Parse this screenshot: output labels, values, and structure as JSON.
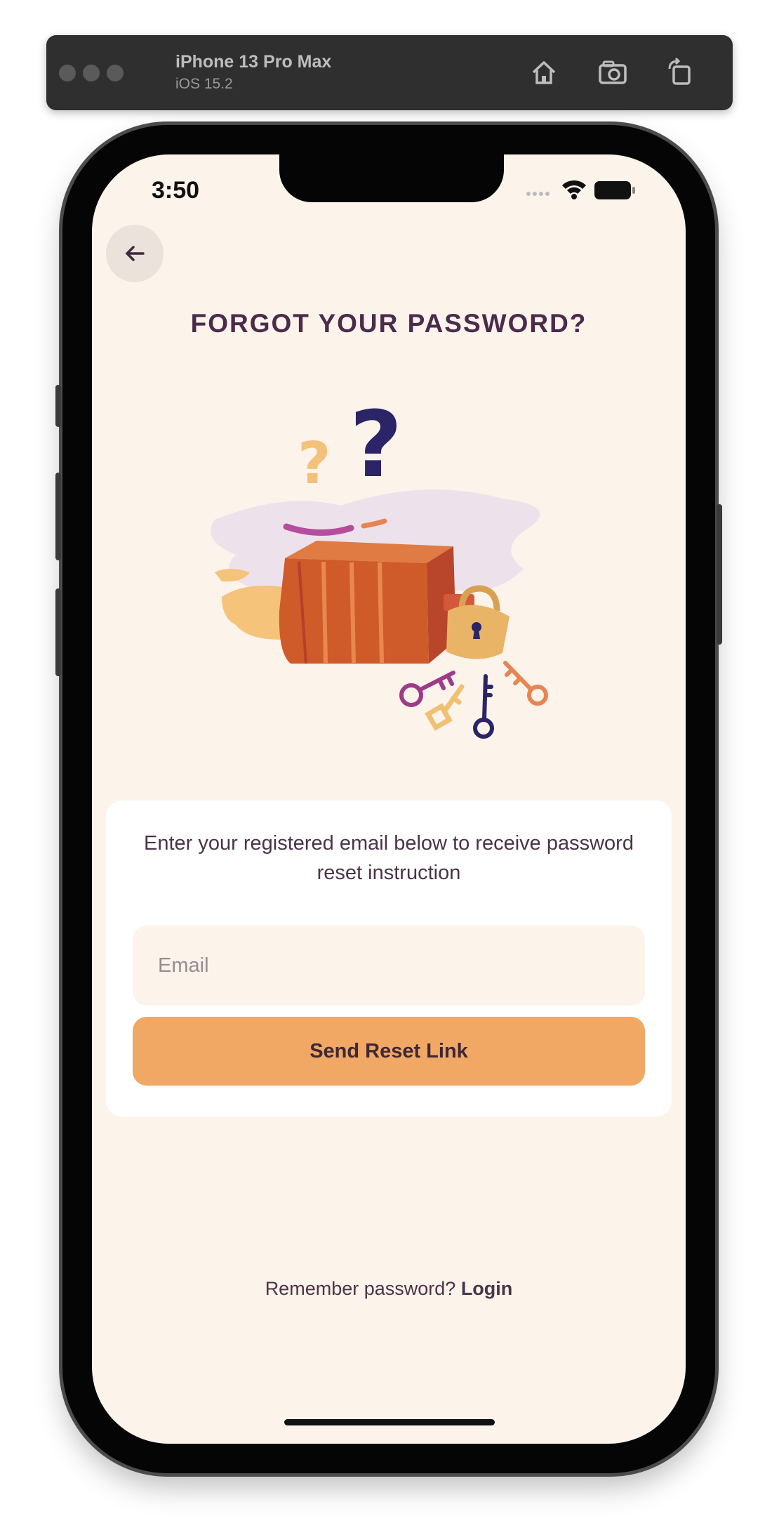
{
  "simulator": {
    "device_name": "iPhone 13 Pro Max",
    "os_version": "iOS 15.2",
    "icons": [
      "home-icon",
      "screenshot-icon",
      "rotate-icon"
    ]
  },
  "status_bar": {
    "time": "3:50",
    "icons": [
      "signal-icon",
      "wifi-icon",
      "battery-icon"
    ]
  },
  "header": {
    "back_icon": "arrow-left-icon",
    "title": "FORGOT YOUR PASSWORD?"
  },
  "colors": {
    "background": "#fcf3ea",
    "title": "#4b2a4c",
    "primary_button": "#f0a864",
    "input_background": "#fcf3ea",
    "card": "#ffffff"
  },
  "card": {
    "instruction": "Enter your registered email below to receive password reset instruction",
    "email_placeholder": "Email",
    "email_value": "",
    "submit_label": "Send Reset Link"
  },
  "footer": {
    "prompt": "Remember password?",
    "link": "Login"
  }
}
